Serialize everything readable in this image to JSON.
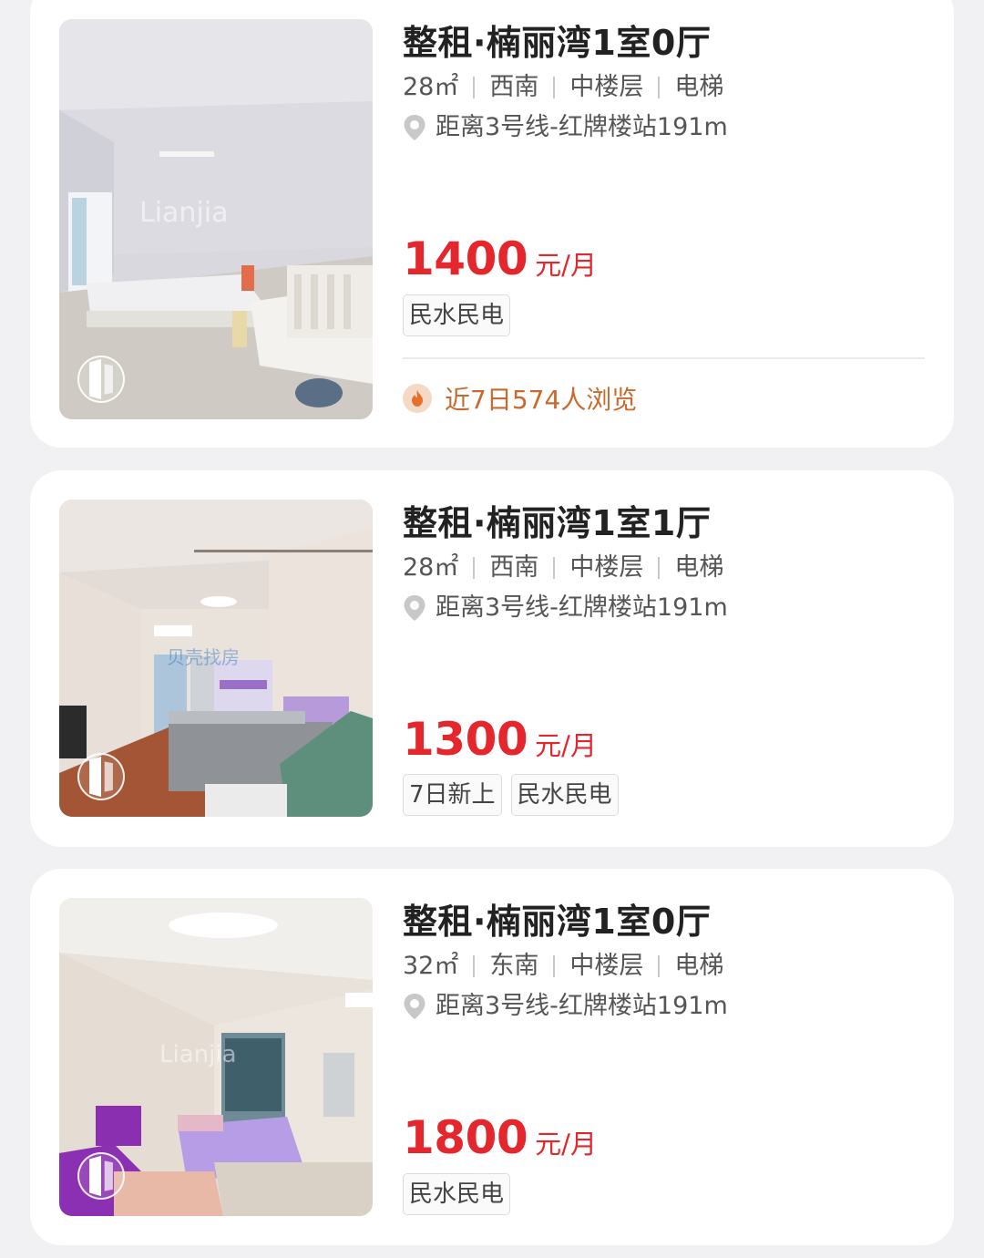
{
  "listings": [
    {
      "title": "整租·楠丽湾1室0厅",
      "area": "28㎡",
      "orientation": "西南",
      "floor": "中楼层",
      "elevator": "电梯",
      "location": "距离3号线-红牌楼站191m",
      "price": "1400",
      "price_unit": "元/月",
      "tags": [
        "民水民电"
      ],
      "views": "近7日574人浏览",
      "watermark": "Lianjia"
    },
    {
      "title": "整租·楠丽湾1室1厅",
      "area": "28㎡",
      "orientation": "西南",
      "floor": "中楼层",
      "elevator": "电梯",
      "location": "距离3号线-红牌楼站191m",
      "price": "1300",
      "price_unit": "元/月",
      "tags": [
        "7日新上",
        "民水民电"
      ],
      "watermark": "贝壳找房"
    },
    {
      "title": "整租·楠丽湾1室0厅",
      "area": "32㎡",
      "orientation": "东南",
      "floor": "中楼层",
      "elevator": "电梯",
      "location": "距离3号线-红牌楼站191m",
      "price": "1800",
      "price_unit": "元/月",
      "tags": [
        "民水民电"
      ],
      "watermark": "Lianjia"
    }
  ],
  "icons": {
    "location": "location-pin-icon",
    "vr": "vr-view-icon",
    "hot": "flame-icon"
  },
  "colors": {
    "price": "#e4262d",
    "views": "#c86a2d",
    "background": "#f1f1f3"
  }
}
